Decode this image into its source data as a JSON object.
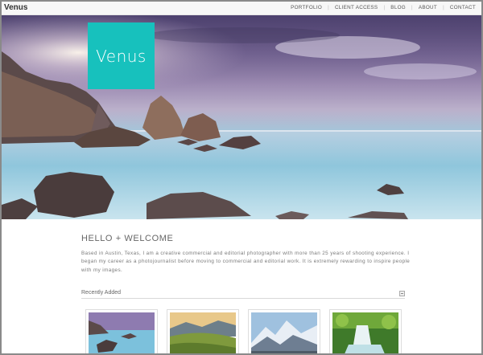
{
  "site": {
    "brand": "Venus",
    "logo_text": "Venus"
  },
  "nav": {
    "items": [
      "PORTFOLIO",
      "CLIENT ACCESS",
      "BLOG",
      "ABOUT",
      "CONTACT"
    ]
  },
  "intro": {
    "title": "HELLO + WELCOME",
    "body": "Based in Austin, Texas, I am a creative commercial and editorial photographer with more than 25 years of shooting experience. I began my career as a photojournalist before moving to commercial and editorial work. It is extremely rewarding to inspire people with my images."
  },
  "recent": {
    "label": "Recently Added"
  },
  "colors": {
    "accent": "#17c1bd"
  }
}
